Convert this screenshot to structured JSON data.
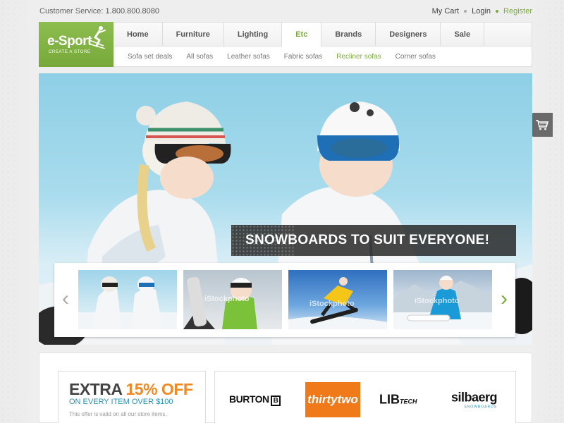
{
  "topbar": {
    "customer_service_label": "Customer Service:",
    "customer_service_phone": "1.800.800.8080",
    "links": [
      "My Cart",
      "Login",
      "Register"
    ]
  },
  "logo": {
    "brand": "e-Sport",
    "tagline": "CREATE A STORE"
  },
  "nav": {
    "main": [
      "Home",
      "Furniture",
      "Lighting",
      "Etc",
      "Brands",
      "Designers",
      "Sale"
    ],
    "active_main": "Etc",
    "sub": [
      "Sofa set deals",
      "All sofas",
      "Leather sofas",
      "Fabric sofas",
      "Recliner sofas",
      "Corner sofas"
    ],
    "active_sub": "Recliner sofas"
  },
  "cart_tab": {
    "icon": "cart-icon"
  },
  "hero": {
    "caption": "SNOWBOARDS TO SUIT EVERYONE!",
    "thumbnail_watermark": "iStockphoto"
  },
  "promo": {
    "prefix": "EXTRA ",
    "highlight": "15% OFF",
    "subtitle": "ON EVERY ITEM OVER $100",
    "note": "This offer is valid on all our store items."
  },
  "brands": {
    "burton": "BURTON",
    "burton_mark": "B",
    "thirtytwo": "thirtytwo",
    "lib": "LIB",
    "lib_suffix": "TECH",
    "silbaerg": "silbaerg",
    "silbaerg_sub": "SNOWBOARDS"
  },
  "colors": {
    "accent": "#7aab3a",
    "promo_orange": "#f08a24",
    "promo_blue": "#2a8fb5",
    "caption_bg": "#2b2b2b"
  }
}
